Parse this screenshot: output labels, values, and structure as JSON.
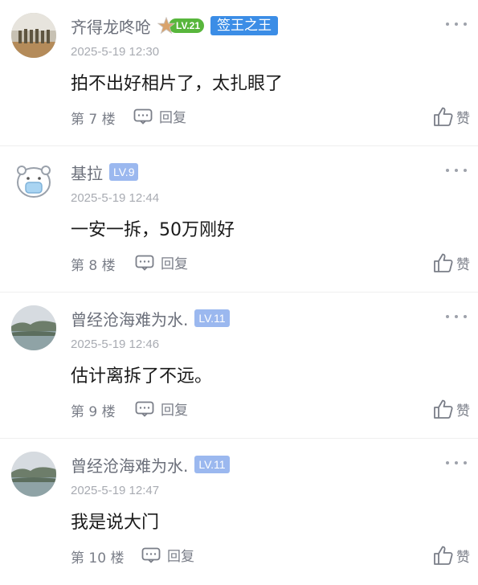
{
  "comments": [
    {
      "username": "齐得龙咚呛",
      "level": "LV.21",
      "title_badge": "签王之王",
      "time": "2025-5-19 12:30",
      "text": "拍不出好相片了，太扎眼了",
      "floor": "第 7 楼",
      "reply_label": "回复",
      "like_label": "赞"
    },
    {
      "username": "基拉",
      "level": "LV.9",
      "time": "2025-5-19 12:44",
      "text": "一安一拆，50万刚好",
      "floor": "第 8 楼",
      "reply_label": "回复",
      "like_label": "赞"
    },
    {
      "username": "曾经沧海难为水.",
      "level": "LV.11",
      "time": "2025-5-19 12:46",
      "text": "估计离拆了不远。",
      "floor": "第 9 楼",
      "reply_label": "回复",
      "like_label": "赞"
    },
    {
      "username": "曾经沧海难为水.",
      "level": "LV.11",
      "time": "2025-5-19 12:47",
      "text": "我是说大门",
      "floor": "第 10 楼",
      "reply_label": "回复",
      "like_label": "赞"
    }
  ],
  "colors": {
    "level_badge": "#9bb8ef",
    "level_badge_green": "#58b63c",
    "title_badge": "#3b8de6",
    "username": "#6b6f7a",
    "meta": "#a8abb2"
  }
}
